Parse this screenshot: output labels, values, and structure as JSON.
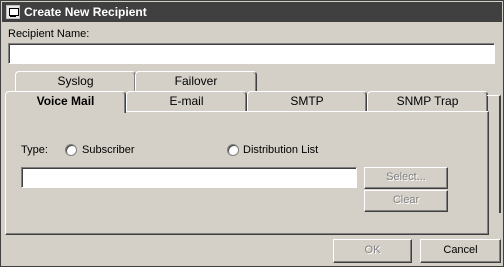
{
  "window": {
    "title": "Create New Recipient"
  },
  "recipient": {
    "label": "Recipient Name:",
    "value": ""
  },
  "tabs": {
    "back_row": [
      {
        "label": "Syslog"
      },
      {
        "label": "Failover"
      }
    ],
    "front_row": [
      {
        "label": "Voice Mail",
        "active": true
      },
      {
        "label": "E-mail"
      },
      {
        "label": "SMTP"
      },
      {
        "label": "SNMP Trap"
      }
    ]
  },
  "voice_mail": {
    "type_label": "Type:",
    "options": [
      {
        "label": "Subscriber",
        "selected": false
      },
      {
        "label": "Distribution List",
        "selected": false
      }
    ],
    "selection_value": "",
    "select_button": "Select...",
    "clear_button": "Clear"
  },
  "footer": {
    "ok_label": "OK",
    "cancel_label": "Cancel"
  },
  "colors": {
    "titlebar_bg": "#404040",
    "dialog_bg": "#d4d0c8",
    "disabled_text": "#808080"
  }
}
